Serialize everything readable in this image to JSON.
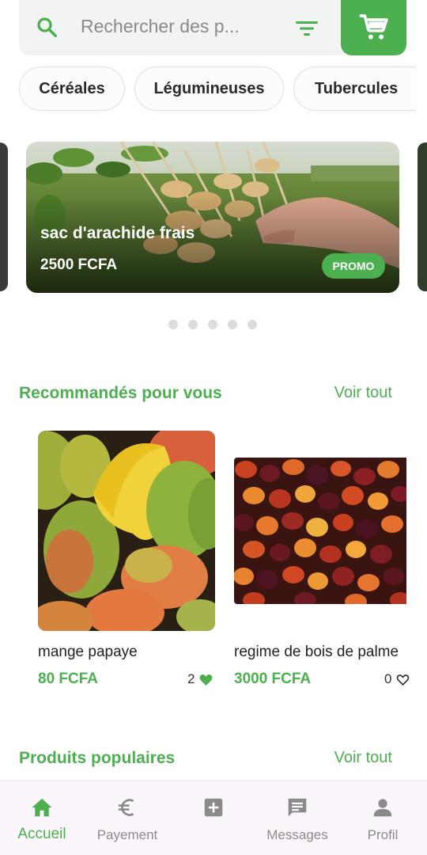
{
  "search": {
    "placeholder_text": "Rechercher des p..."
  },
  "icons": {
    "search": "search-icon",
    "filter": "filter-icon",
    "cart": "cart-icon"
  },
  "colors": {
    "accent": "#4caf50",
    "chip_bg": "#fdfbfd",
    "nav_bg": "#fbf6fb"
  },
  "categories": [
    "Céréales",
    "Légumineuses",
    "Tubercules"
  ],
  "banner": {
    "title": "sac d'arachide frais",
    "price": "2500 FCFA",
    "badge": "PROMO"
  },
  "carousel": {
    "slide_count": 5,
    "active_index": 0
  },
  "recommended": {
    "title": "Recommandés pour vous",
    "view_all": "Voir tout",
    "products": [
      {
        "name": "mange papaye",
        "price": "80 FCFA",
        "likes": "2",
        "liked": true
      },
      {
        "name": "regime de bois de palme",
        "price": "3000 FCFA",
        "likes": "0",
        "liked": false
      }
    ]
  },
  "popular": {
    "title": "Produits populaires",
    "view_all": "Voir tout"
  },
  "nav": {
    "items": [
      {
        "label": "Accueil",
        "icon": "home-icon",
        "active": true
      },
      {
        "label": "Payement",
        "icon": "euro-icon",
        "active": false
      },
      {
        "label": "",
        "icon": "add-box-icon",
        "active": false
      },
      {
        "label": "Messages",
        "icon": "message-icon",
        "active": false
      },
      {
        "label": "Profil",
        "icon": "person-icon",
        "active": false
      }
    ]
  }
}
